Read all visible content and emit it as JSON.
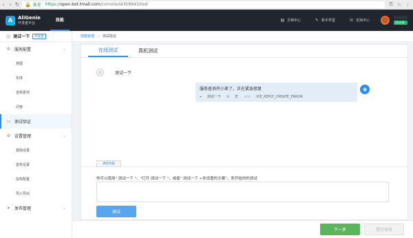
{
  "browser": {
    "secure_label": "安全",
    "url_proto": "https://",
    "url_host": "open.bot.tmall.com",
    "url_path": "/console/skill/8843/test"
  },
  "header": {
    "brand": "AliGenie",
    "brand_sub": "开发者平台",
    "nav_tab": "技能",
    "links": [
      "文档中心",
      "新手学堂",
      "支持中心"
    ],
    "verified_label": "已认证"
  },
  "sidebar": {
    "skill_title": "测试一下",
    "skill_tag": "开发版",
    "groups": [
      {
        "label": "服务配置",
        "items": [
          "意图",
          "实体",
          "音频素材",
          "问答"
        ]
      },
      {
        "label": "测试验证",
        "items": []
      },
      {
        "label": "设置管理",
        "items": [
          "基础设置",
          "鉴权设置",
          "授权配置",
          "导入导出"
        ]
      },
      {
        "label": "发布管理",
        "items": []
      }
    ]
  },
  "breadcrumb": {
    "parent": "技能管理",
    "current": "测试验证"
  },
  "panel": {
    "tabs": [
      "在线测试",
      "真机测试"
    ],
    "user_message": "测试一下",
    "bot_message": "服务查询开小差了，正在紧急修复",
    "bot_meta": {
      "skill": "测试一下",
      "none_label": "无",
      "code": "IDE_REPLY_CREATE_ERROR"
    },
    "clear_label": "清空内容",
    "hint": "你可以使用\" 测试一下 \"、\"打开 测试一下 \"，或者\" 测试一下 +你设置的文案\"，来开始你的测试",
    "test_button": "测试"
  },
  "footer": {
    "next_button": "下一步",
    "submit_button": "提交审核"
  }
}
